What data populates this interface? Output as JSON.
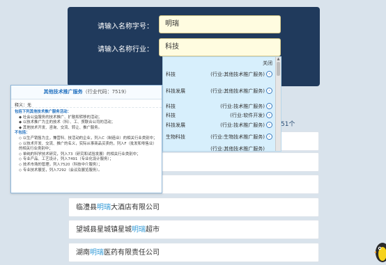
{
  "search": {
    "name_label": "请输入名称字号：",
    "name_value": "明瑞",
    "industry_label": "请输入名称行业：",
    "industry_value": "科技"
  },
  "dropdown": {
    "close_label": "关闭",
    "items": [
      {
        "name": "科技",
        "category": "(行业:其他技术推广服务)"
      },
      {
        "name": "科技发展",
        "category": "(行业:其他技术推广服务)"
      },
      {
        "name": "科技",
        "category": "(行业:技术推广服务)"
      },
      {
        "name": "科技",
        "category": "(行业:软件开发)"
      },
      {
        "name": "科技发展",
        "category": "(行业:技术推广服务)"
      },
      {
        "name": "生物科技",
        "category": "(行业:生物技术推广服务)"
      },
      {
        "name": "",
        "category": "(行业:其他技术推广服务)"
      }
    ]
  },
  "popup": {
    "title": "其他技术推广服务",
    "code": "（行业代码：7519）",
    "alias": "释义：无",
    "include_heading": "包括下列其他技术推广服务活动：",
    "include_items": [
      "◆ 社会公益服务的技术推广、扩散和转移的活动；",
      "◆ 以技术推广为主的技术（科）、工、贸联合公司的活动；",
      "◆ 其他技术开发、咨询、交流、转让、推广服务。"
    ],
    "exclude_heading": "不包括：",
    "exclude_items": [
      "◇ 以生产销售为主，兼营科、技活动的企业，列入C（制造业）的相关行业类别中；",
      "◇ 以技术开发、交流、推广的名义，实际从事商品买卖的，列入F（批发和零售业）的相关行业类别中；",
      "◇ 单纯的科学技术研究，列入73（研究和试验发展）的相关行业类别中；",
      "◇ 专业产品、工艺设计，列入7491（专业化设计服务）；",
      "◇ 技术市场的管理，列入7520（科技中介服务）；",
      "◇ 专业技术展览，列入7292（会议及展览服务）。"
    ]
  },
  "results": {
    "count_text": "约51个",
    "items": [
      {
        "prefix": "",
        "highlight": "",
        "suffix": ""
      },
      {
        "prefix": "",
        "highlight": "",
        "suffix": ""
      },
      {
        "prefix": "",
        "highlight": "",
        "suffix": ""
      },
      {
        "prefix": "临澧县",
        "highlight": "明瑞",
        "suffix": "大酒店有限公司"
      },
      {
        "prefix": "望城县星城镇星城",
        "highlight": "明瑞",
        "suffix": "超市"
      },
      {
        "prefix": "湖南",
        "highlight": "明瑞",
        "suffix": "医药有限责任公司"
      }
    ]
  },
  "colors": {
    "hero_bg": "#203a5c",
    "highlight": "#2e98d6",
    "dropdown_bg": "#d7effc"
  }
}
